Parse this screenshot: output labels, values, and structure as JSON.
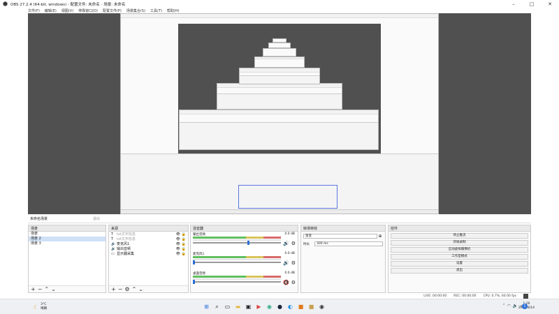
{
  "window": {
    "title": "OBS 27.2.4 (64-bit, windows) - 配置文件: 未命名 - 场景: 未命名"
  },
  "menu": [
    "文件(F)",
    "编辑(E)",
    "视图(V)",
    "停靠窗口(D)",
    "配置文件(P)",
    "场景集合(S)",
    "工具(T)",
    "帮助(H)"
  ],
  "scenebar": {
    "current": "未命名场景",
    "toggle": "退出"
  },
  "docks": {
    "scenes": "场景",
    "sources": "来源",
    "mixer": "混音器",
    "transitions": "转场特效",
    "controls": "控件"
  },
  "scenes": [
    "场景",
    "场景 2",
    "场景 3"
  ],
  "sources": [
    {
      "icon": "text-icon",
      "glyph": "T",
      "label": "txt文字信息",
      "dim": true
    },
    {
      "icon": "text-icon",
      "glyph": "T",
      "label": "txt文字信息",
      "dim": true
    },
    {
      "icon": "audio-icon",
      "glyph": "🔊",
      "label": "麦克风1",
      "dim": false
    },
    {
      "icon": "audio-icon",
      "glyph": "🔊",
      "label": "输出音频",
      "dim": false
    },
    {
      "icon": "display-icon",
      "glyph": "▭",
      "label": "显示器采集",
      "dim": false
    }
  ],
  "mixer": [
    {
      "name": "输出音频",
      "db": "0.0 dB",
      "level": 0.62,
      "muted": false
    },
    {
      "name": "麦克风1",
      "db": "0.0 dB",
      "level": 0.0,
      "muted": false
    },
    {
      "name": "桌面音频",
      "db": "0.0 dB",
      "level": 0.0,
      "muted": true
    }
  ],
  "transitions": {
    "selected": "渐变",
    "duration_label": "时长",
    "duration": "300 ms"
  },
  "controls": [
    "停止推流",
    "开始录制",
    "启动虚拟摄像机",
    "工作室模式",
    "设置",
    "退出"
  ],
  "status": {
    "live": "LIVE: 00:00:00",
    "rec": "REC: 00:00:00",
    "cpu": "CPU: 0.7%, 60.00 fps"
  },
  "taskbar": {
    "weather_temp": "3°C",
    "weather_text": "晴朗",
    "time": "1:26",
    "date": "2022/8/14",
    "notifications": "1"
  },
  "colors": {
    "preview_bg": "#505050",
    "accent": "#2b6fd8",
    "selection": "#cfe0f7"
  }
}
